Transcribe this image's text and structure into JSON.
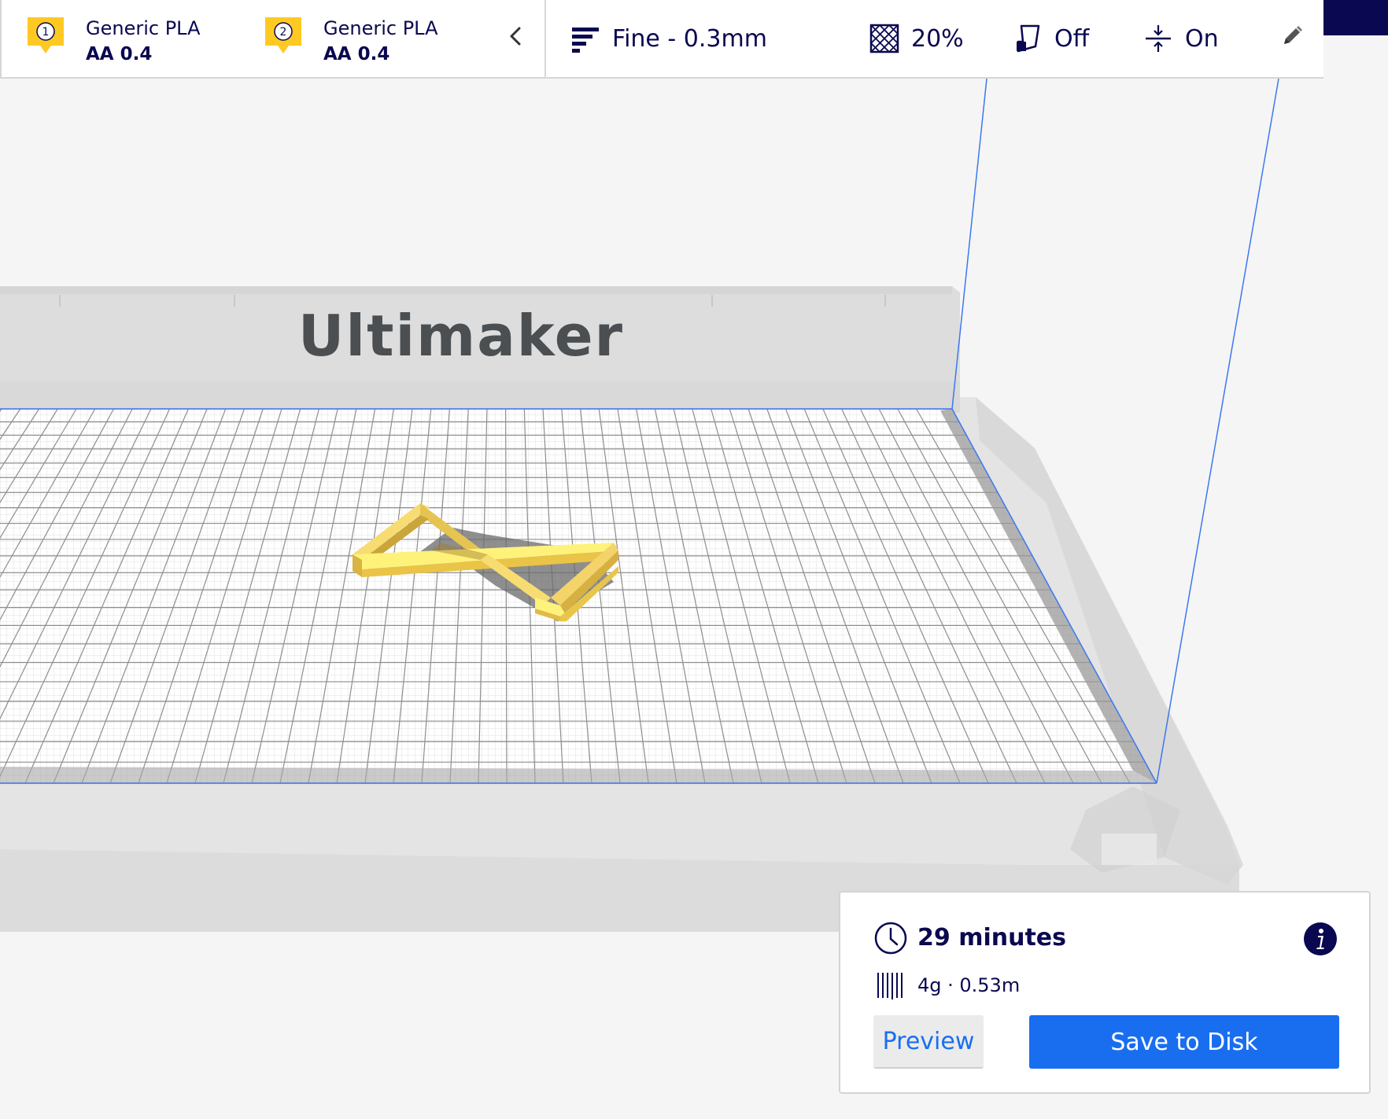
{
  "toolbar": {
    "extruders": [
      {
        "number": "1",
        "material": "Generic PLA",
        "nozzle": "AA 0.4"
      },
      {
        "number": "2",
        "material": "Generic PLA",
        "nozzle": "AA 0.4"
      }
    ],
    "profile": "Fine - 0.3mm",
    "infill": "20%",
    "support": "Off",
    "adhesion": "On"
  },
  "scene": {
    "brand_text": "Ultimaker"
  },
  "output": {
    "print_time": "29 minutes",
    "material_usage": "4g · 0.53m",
    "preview_label": "Preview",
    "save_label": "Save to Disk"
  },
  "colors": {
    "accent": "#196ef0",
    "navy": "#0a0850",
    "extruder_badge": "#ffc924",
    "model": "#f3d36a"
  },
  "icons": {
    "profile": "profile-lines-icon",
    "infill": "infill-pattern-icon",
    "support": "support-icon",
    "adhesion": "adhesion-icon",
    "edit": "pencil-icon",
    "collapse": "chevron-left-icon",
    "time": "clock-icon",
    "material": "filament-icon",
    "info": "info-icon"
  }
}
